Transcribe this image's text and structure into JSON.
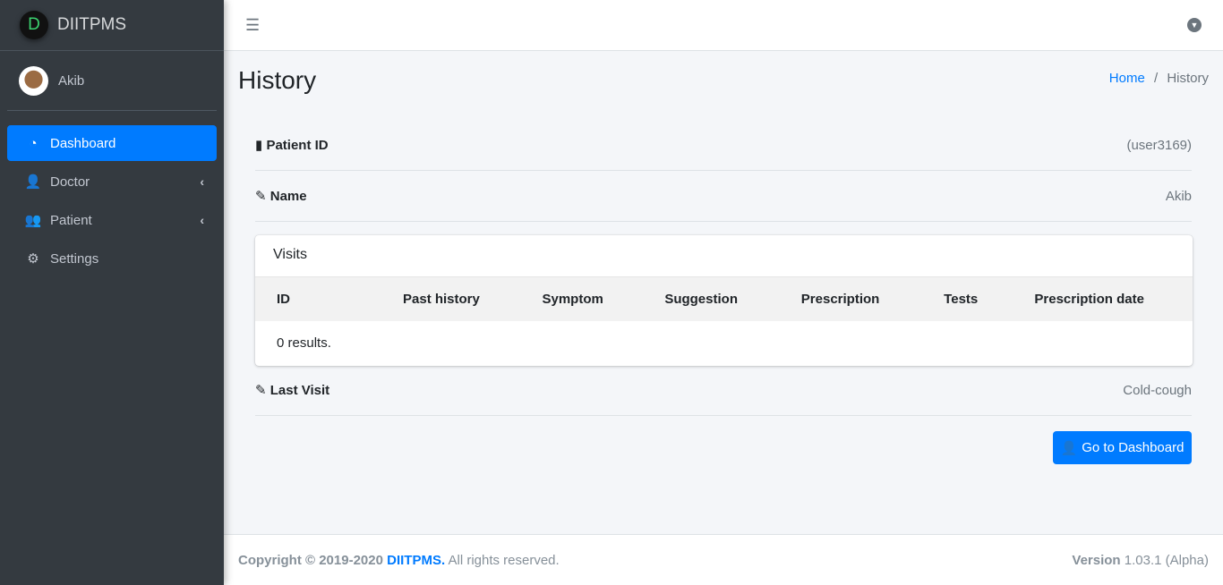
{
  "brand": {
    "logo_letter": "D",
    "name": "DIITPMS"
  },
  "user": {
    "name": "Akib"
  },
  "sidebar": {
    "items": [
      {
        "label": "Dashboard",
        "icon": "tachometer-icon",
        "active": true
      },
      {
        "label": "Doctor",
        "icon": "user-md-icon"
      },
      {
        "label": "Patient",
        "icon": "users-icon"
      },
      {
        "label": "Settings",
        "icon": "cogs-icon"
      }
    ]
  },
  "page": {
    "title": "History",
    "breadcrumb": {
      "home": "Home",
      "sep": "/",
      "current": "History"
    }
  },
  "fields": {
    "patient_id": {
      "label": "Patient ID",
      "value": "(user3169)"
    },
    "name": {
      "label": "Name",
      "value": "Akib"
    },
    "last_visit": {
      "label": "Last Visit",
      "value": "Cold-cough"
    }
  },
  "visits": {
    "title": "Visits",
    "columns": [
      "ID",
      "Past history",
      "Symptom",
      "Suggestion",
      "Prescription",
      "Tests",
      "Prescription date"
    ],
    "empty": "0 results."
  },
  "button": {
    "label": "Go to Dashboard"
  },
  "footer": {
    "copyright": "Copyright © 2019-2020",
    "brand": "DIITPMS.",
    "rights": "All rights reserved.",
    "version_label": "Version",
    "version": "1.03.1 (Alpha)"
  }
}
